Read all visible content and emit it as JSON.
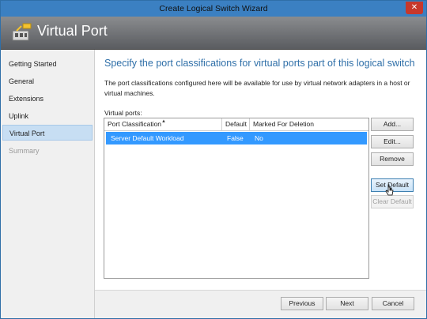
{
  "window": {
    "title": "Create Logical Switch Wizard",
    "close_glyph": "✕"
  },
  "header": {
    "title": "Virtual Port",
    "icon": "virtual-port-icon"
  },
  "nav": {
    "items": [
      {
        "label": "Getting Started",
        "state": "normal"
      },
      {
        "label": "General",
        "state": "normal"
      },
      {
        "label": "Extensions",
        "state": "normal"
      },
      {
        "label": "Uplink",
        "state": "normal"
      },
      {
        "label": "Virtual Port",
        "state": "active"
      },
      {
        "label": "Summary",
        "state": "disabled"
      }
    ]
  },
  "main": {
    "heading": "Specify the port classifications for virtual ports part of this logical switch",
    "description": "The port classifications configured here will be available for use by virtual network adapters in a host or virtual machines.",
    "grid_label": "Virtual ports:",
    "columns": [
      "Port Classification",
      "Default",
      "Marked For Deletion"
    ],
    "rows": [
      {
        "classification": "Server Default Workload",
        "default": "False",
        "deletion": "No",
        "selected": true
      }
    ]
  },
  "side_buttons": {
    "add": "Add...",
    "edit": "Edit...",
    "remove": "Remove",
    "set_default": "Set Default",
    "clear_default": "Clear Default"
  },
  "footer": {
    "previous": "Previous",
    "next": "Next",
    "cancel": "Cancel"
  },
  "colors": {
    "accent": "#2f6fa8",
    "selection": "#3399ff",
    "titlebar": "#3b80c2",
    "close": "#c7382b"
  }
}
